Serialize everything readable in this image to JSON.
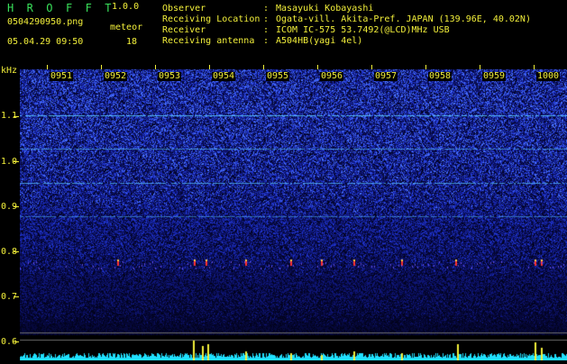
{
  "header": {
    "app_title": "H R O F F T",
    "version": "1.0.0",
    "filename": "0504290950.png",
    "meteor_label": "meteor",
    "meteor_count": "18",
    "datetime": "05.04.29 09:50"
  },
  "station": {
    "rows": [
      {
        "label": "Observer",
        "sep": ":",
        "value": "Masayuki Kobayashi"
      },
      {
        "label": "Receiving Location",
        "sep": ":",
        "value": "Ogata-vill. Akita-Pref. JAPAN (139.96E, 40.02N)"
      },
      {
        "label": "Receiver",
        "sep": ":",
        "value": "ICOM IC-575 53.7492(@LCD)MHz USB"
      },
      {
        "label": "Receiving antenna",
        "sep": ":",
        "value": "A504HB(yagi 4el)"
      }
    ]
  },
  "spectrogram": {
    "unit": "kHz",
    "y_ticks": [
      "1.1",
      "1.0",
      "0.9",
      "0.8",
      "0.7",
      "0.6"
    ],
    "minute_labels": [
      "0951",
      "0952",
      "0953",
      "0954",
      "0955",
      "0956",
      "0957",
      "0958",
      "0959",
      "1000"
    ],
    "colors": {
      "low": "#05062a",
      "mid": "#1f2fb0",
      "high": "#6a8cff",
      "line": "#4fd0ff",
      "meteor": "#ff3030",
      "trace": "#20e0ff",
      "label": "#f2ef3a"
    }
  }
}
